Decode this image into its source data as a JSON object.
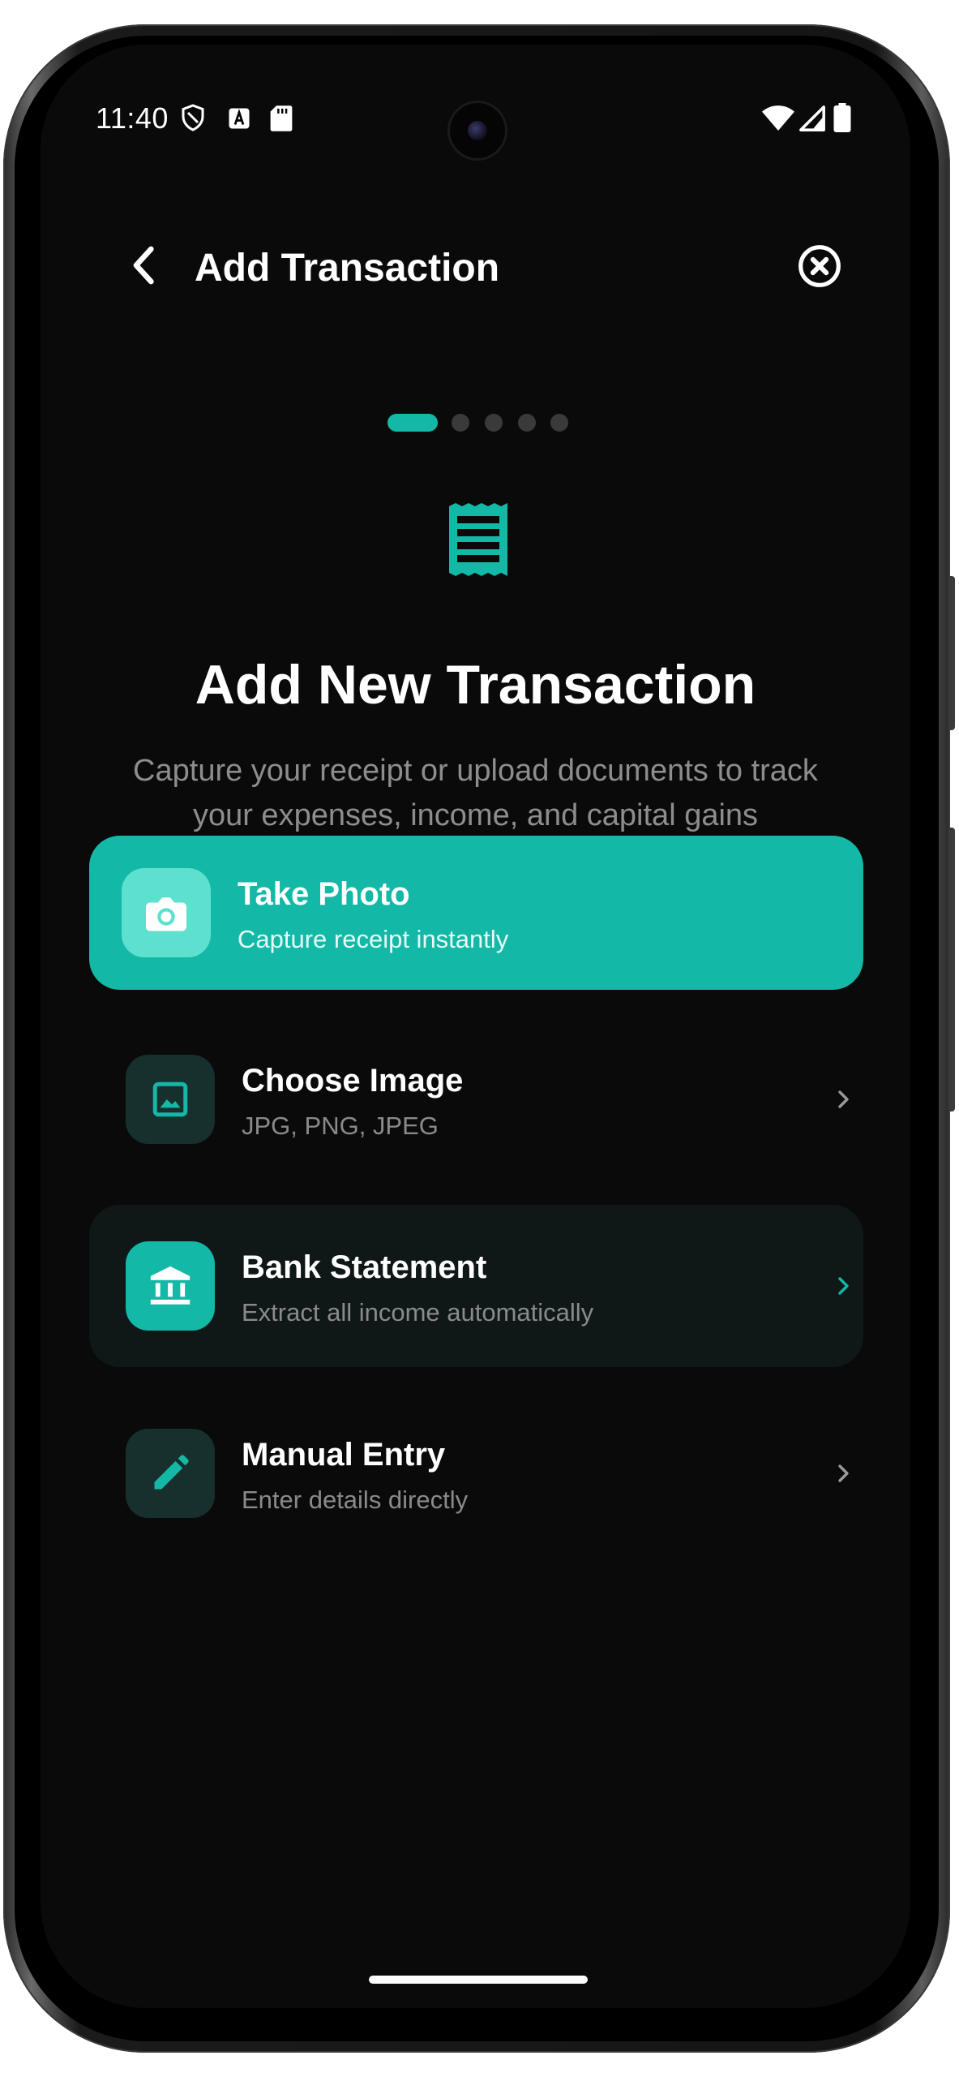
{
  "status_bar": {
    "time": "11:40"
  },
  "header": {
    "title": "Add Transaction"
  },
  "progress": {
    "total_steps": 5,
    "current_step": 1
  },
  "hero": {
    "title": "Add New Transaction",
    "subtitle": "Capture your receipt or upload documents to track your expenses, income, and capital gains"
  },
  "options": {
    "take_photo": {
      "title": "Take Photo",
      "subtitle": "Capture receipt instantly",
      "icon": "camera-icon"
    },
    "choose_image": {
      "title": "Choose Image",
      "subtitle": "JPG, PNG, JPEG",
      "icon": "image-icon"
    },
    "bank_statement": {
      "title": "Bank Statement",
      "subtitle": "Extract all income automatically",
      "icon": "bank-icon"
    },
    "manual_entry": {
      "title": "Manual Entry",
      "subtitle": "Enter details directly",
      "icon": "pencil-icon"
    }
  },
  "colors": {
    "accent": "#14b8a6",
    "background": "#0a0a0a",
    "muted_text": "#8d8d8d"
  }
}
